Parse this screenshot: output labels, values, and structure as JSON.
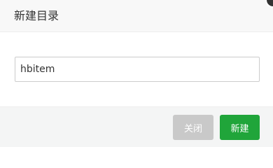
{
  "dialog": {
    "title": "新建目录",
    "close_icon": "close-icon"
  },
  "form": {
    "directory_name_value": "hbitem",
    "directory_name_placeholder": ""
  },
  "footer": {
    "close_label": "关闭",
    "create_label": "新建"
  },
  "colors": {
    "header_bg": "#f8f8f8",
    "footer_bg": "#f4f5f5",
    "close_button": "#c9c9c9",
    "create_button": "#20a53a"
  }
}
